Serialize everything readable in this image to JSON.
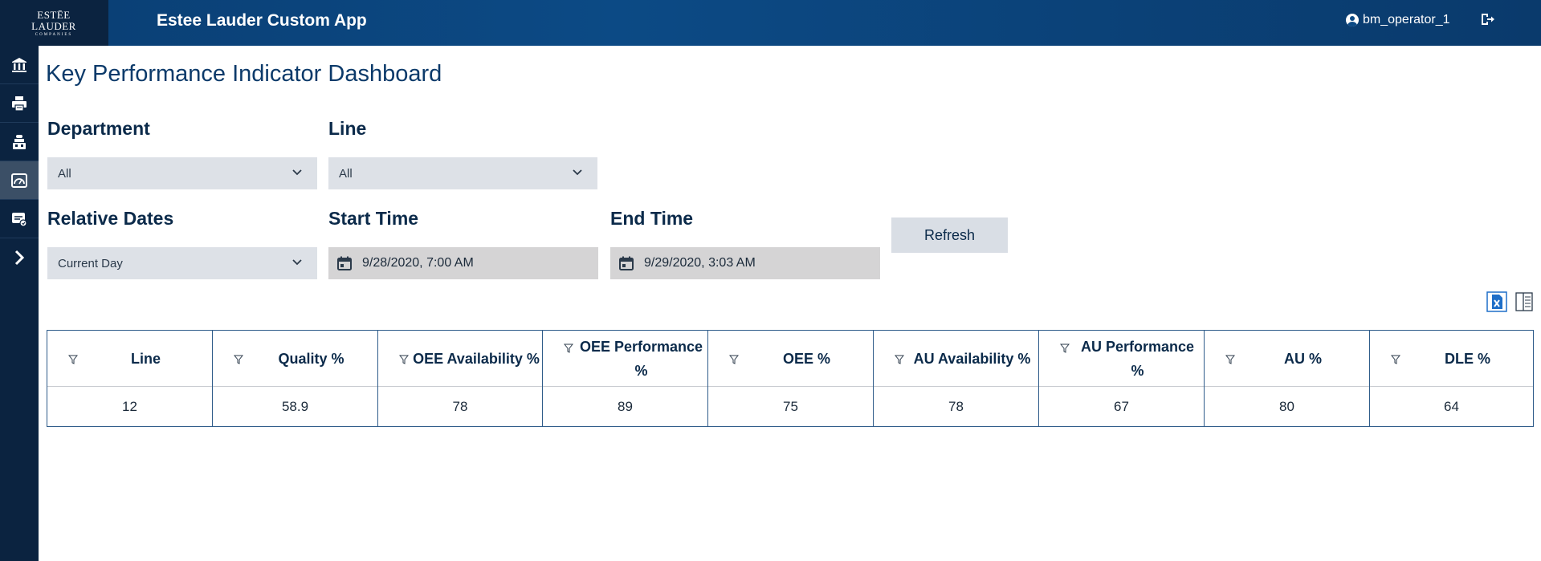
{
  "header": {
    "logo": {
      "line1": "ESTĒE",
      "line2": "LAUDER",
      "line3": "COMPANIES"
    },
    "app_title": "Estee Lauder Custom App",
    "username": "bm_operator_1",
    "icons": {
      "user": "user-circle-icon",
      "logout": "logout-icon"
    }
  },
  "sidebar": {
    "items": [
      {
        "icon": "bank-icon"
      },
      {
        "icon": "printer-icon"
      },
      {
        "icon": "factory-icon"
      },
      {
        "icon": "dashboard-gauge-icon",
        "active": true
      },
      {
        "icon": "report-icon"
      },
      {
        "icon": "chevron-right-icon"
      }
    ]
  },
  "page": {
    "title": "Key Performance Indicator Dashboard"
  },
  "filters": {
    "department": {
      "label": "Department",
      "value": "All"
    },
    "line": {
      "label": "Line",
      "value": "All"
    },
    "relative_dates": {
      "label": "Relative Dates",
      "value": "Current Day"
    },
    "start_time": {
      "label": "Start Time",
      "value": "9/28/2020, 7:00 AM"
    },
    "end_time": {
      "label": "End Time",
      "value": "9/29/2020, 3:03 AM"
    },
    "refresh_label": "Refresh"
  },
  "toolbar": {
    "icons": [
      "excel-export-icon",
      "column-chooser-icon"
    ]
  },
  "table": {
    "columns": [
      "Line",
      "Quality %",
      "OEE Availability %",
      "OEE Performance %",
      "OEE %",
      "AU Availability %",
      "AU Performance %",
      "AU %",
      "DLE %"
    ],
    "rows": [
      [
        "12",
        "58.9",
        "78",
        "89",
        "75",
        "78",
        "67",
        "80",
        "64"
      ]
    ]
  },
  "colors": {
    "header_bg": "#0c4a85",
    "sidebar_bg": "#0b2340",
    "select_bg": "#dde1e7",
    "date_bg": "#d5d4d5",
    "accent": "#0c3a6a"
  }
}
